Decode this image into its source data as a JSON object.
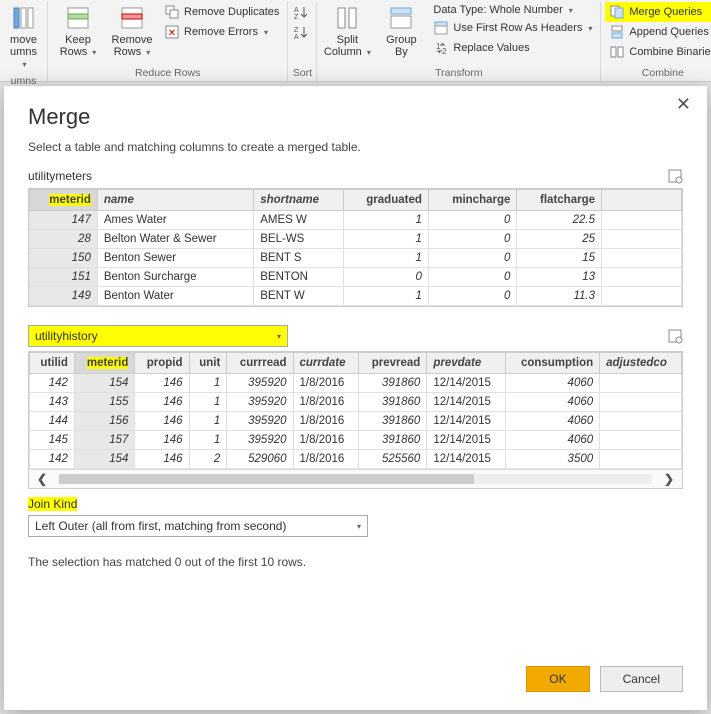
{
  "ribbon": {
    "groups": {
      "manage_columns": {
        "label": "umns",
        "move_columns": "move\numns"
      },
      "reduce_rows": {
        "label": "Reduce Rows",
        "keep_rows": "Keep\nRows",
        "remove_rows": "Remove\nRows",
        "remove_duplicates": "Remove Duplicates",
        "remove_errors": "Remove Errors"
      },
      "sort": {
        "label": "Sort"
      },
      "transform": {
        "label": "Transform",
        "split_column": "Split\nColumn",
        "group_by": "Group\nBy",
        "data_type": "Data Type: Whole Number",
        "first_row_headers": "Use First Row As Headers",
        "replace_values": "Replace Values"
      },
      "combine": {
        "label": "Combine",
        "merge_queries": "Merge Queries",
        "append_queries": "Append Queries",
        "combine_binaries": "Combine Binaries"
      }
    }
  },
  "dialog": {
    "title": "Merge",
    "subtitle": "Select a table and matching columns to create a merged table.",
    "table1_name": "utilitymeters",
    "table2_name": "utilityhistory",
    "join_kind_label": "Join Kind",
    "join_kind_value": "Left Outer (all from first, matching from second)",
    "status": "The selection has matched 0 out of the first 10 rows.",
    "ok": "OK",
    "cancel": "Cancel"
  },
  "table1": {
    "columns": [
      "meterid",
      "name",
      "shortname",
      "graduated",
      "mincharge",
      "flatcharge"
    ],
    "rows": [
      {
        "meterid": 147,
        "name": "Ames Water",
        "shortname": "AMES W",
        "graduated": 1,
        "mincharge": 0,
        "flatcharge": 22.5
      },
      {
        "meterid": 28,
        "name": "Belton Water & Sewer",
        "shortname": "BEL-WS",
        "graduated": 1,
        "mincharge": 0,
        "flatcharge": 25
      },
      {
        "meterid": 150,
        "name": "Benton Sewer",
        "shortname": "BENT S",
        "graduated": 1,
        "mincharge": 0,
        "flatcharge": 15
      },
      {
        "meterid": 151,
        "name": "Benton Surcharge",
        "shortname": "BENTON",
        "graduated": 0,
        "mincharge": 0,
        "flatcharge": 13
      },
      {
        "meterid": 149,
        "name": "Benton Water",
        "shortname": "BENT W",
        "graduated": 1,
        "mincharge": 0,
        "flatcharge": 11.3
      }
    ]
  },
  "table2": {
    "columns": [
      "utilid",
      "meterid",
      "propid",
      "unit",
      "currread",
      "currdate",
      "prevread",
      "prevdate",
      "consumption",
      "adjustedco"
    ],
    "rows": [
      {
        "utilid": 142,
        "meterid": 154,
        "propid": 146,
        "unit": 1,
        "currread": 395920,
        "currdate": "1/8/2016",
        "prevread": 391860,
        "prevdate": "12/14/2015",
        "consumption": 4060
      },
      {
        "utilid": 143,
        "meterid": 155,
        "propid": 146,
        "unit": 1,
        "currread": 395920,
        "currdate": "1/8/2016",
        "prevread": 391860,
        "prevdate": "12/14/2015",
        "consumption": 4060
      },
      {
        "utilid": 144,
        "meterid": 156,
        "propid": 146,
        "unit": 1,
        "currread": 395920,
        "currdate": "1/8/2016",
        "prevread": 391860,
        "prevdate": "12/14/2015",
        "consumption": 4060
      },
      {
        "utilid": 145,
        "meterid": 157,
        "propid": 146,
        "unit": 1,
        "currread": 395920,
        "currdate": "1/8/2016",
        "prevread": 391860,
        "prevdate": "12/14/2015",
        "consumption": 4060
      },
      {
        "utilid": 142,
        "meterid": 154,
        "propid": 146,
        "unit": 2,
        "currread": 529060,
        "currdate": "1/8/2016",
        "prevread": 525560,
        "prevdate": "12/14/2015",
        "consumption": 3500
      }
    ]
  }
}
